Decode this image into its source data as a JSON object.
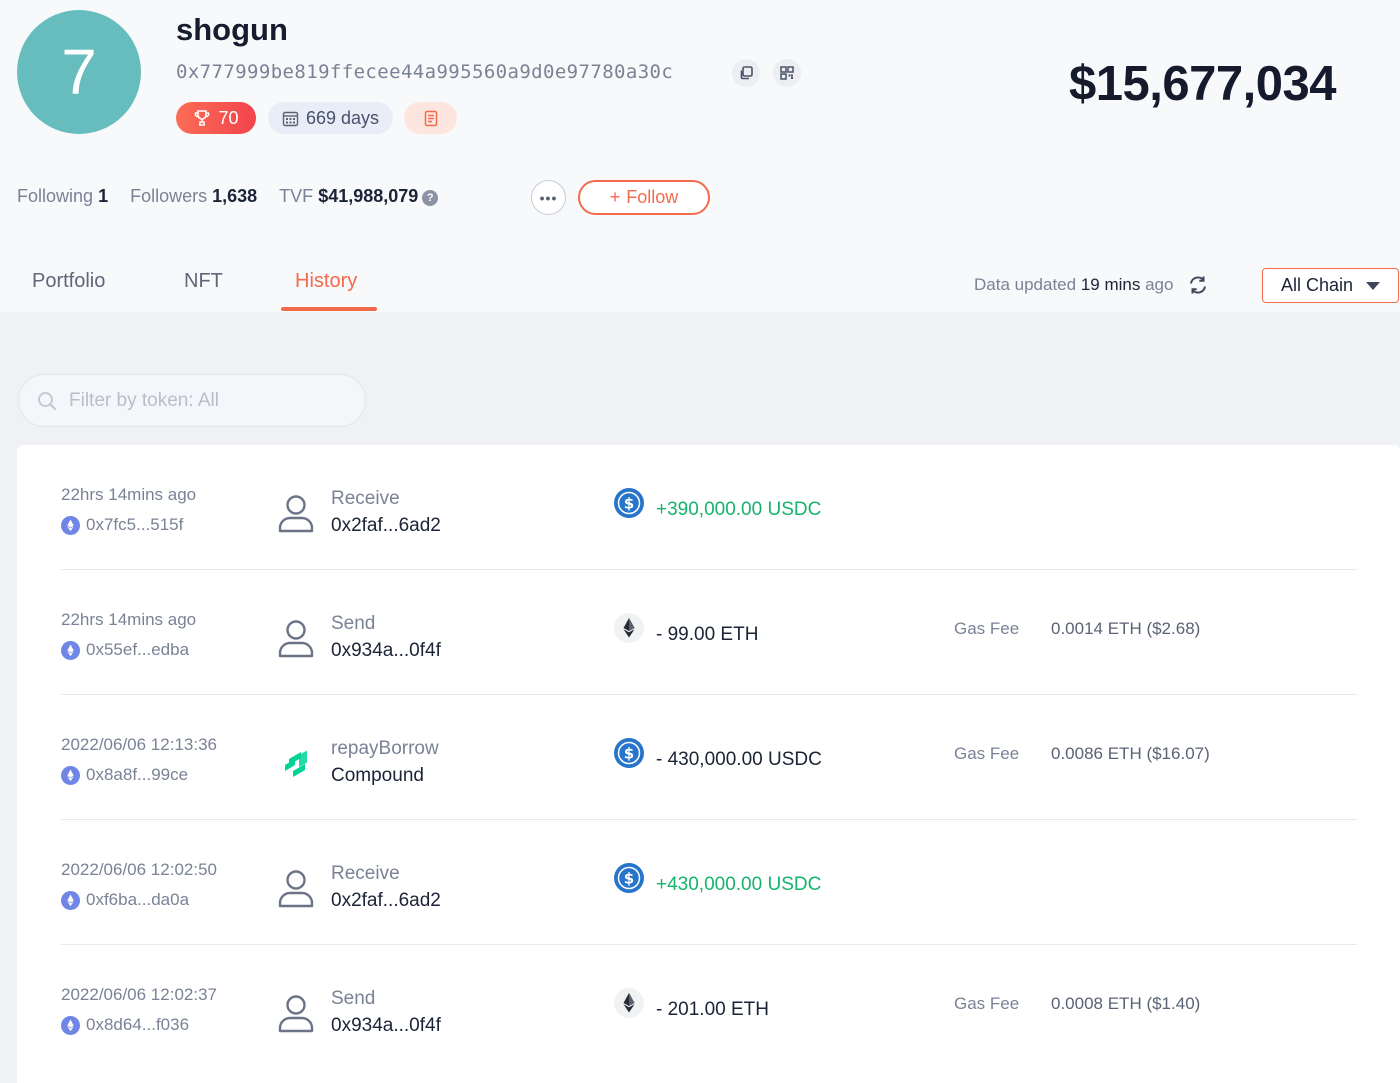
{
  "profile": {
    "avatar_text": "7",
    "name": "shogun",
    "address": "0x777999be819ffecee44a995560a9d0e97780a30c",
    "score": "70",
    "age": "669 days",
    "total_balance": "$15,677,034"
  },
  "stats": {
    "following_label": "Following",
    "following_value": "1",
    "followers_label": "Followers",
    "followers_value": "1,638",
    "tvf_label": "TVF",
    "tvf_value": "$41,988,079"
  },
  "actions": {
    "more": "•••",
    "follow_label": "Follow",
    "follow_icon": "+"
  },
  "tabs": [
    {
      "label": "Portfolio",
      "active": false
    },
    {
      "label": "NFT",
      "active": false
    },
    {
      "label": "History",
      "active": true
    }
  ],
  "data_updated": {
    "prefix": "Data updated",
    "value": "19 mins",
    "suffix": "ago"
  },
  "chain_filter": {
    "selected": "All Chain"
  },
  "search": {
    "placeholder": "Filter by token: All",
    "value": ""
  },
  "colors": {
    "accent": "#f46a4c",
    "positive": "#16b36e",
    "avatar": "#67bdbd",
    "usdc": "#2775ca",
    "compound": "#00d395"
  },
  "history": [
    {
      "time": "22hrs 14mins ago",
      "tx_hash": "0x7fc5...515f",
      "actor_icon": "person-icon",
      "action": "Receive",
      "counterparty": "0x2faf...6ad2",
      "token_icon": "usdc-icon",
      "amount": "+390,000.00 USDC",
      "direction": "in",
      "gas_label": "",
      "gas_fee": ""
    },
    {
      "time": "22hrs 14mins ago",
      "tx_hash": "0x55ef...edba",
      "actor_icon": "person-icon",
      "action": "Send",
      "counterparty": "0x934a...0f4f",
      "token_icon": "eth-icon",
      "amount": "- 99.00 ETH",
      "direction": "out",
      "gas_label": "Gas Fee",
      "gas_fee": "0.0014 ETH ($2.68)"
    },
    {
      "time": "2022/06/06 12:13:36",
      "tx_hash": "0x8a8f...99ce",
      "actor_icon": "compound-icon",
      "action": "repayBorrow",
      "counterparty": "Compound",
      "token_icon": "usdc-icon",
      "amount": "- 430,000.00 USDC",
      "direction": "out",
      "gas_label": "Gas Fee",
      "gas_fee": "0.0086 ETH ($16.07)"
    },
    {
      "time": "2022/06/06 12:02:50",
      "tx_hash": "0xf6ba...da0a",
      "actor_icon": "person-icon",
      "action": "Receive",
      "counterparty": "0x2faf...6ad2",
      "token_icon": "usdc-icon",
      "amount": "+430,000.00 USDC",
      "direction": "in",
      "gas_label": "",
      "gas_fee": ""
    },
    {
      "time": "2022/06/06 12:02:37",
      "tx_hash": "0x8d64...f036",
      "actor_icon": "person-icon",
      "action": "Send",
      "counterparty": "0x934a...0f4f",
      "token_icon": "eth-icon",
      "amount": "- 201.00 ETH",
      "direction": "out",
      "gas_label": "Gas Fee",
      "gas_fee": "0.0008 ETH ($1.40)"
    }
  ]
}
